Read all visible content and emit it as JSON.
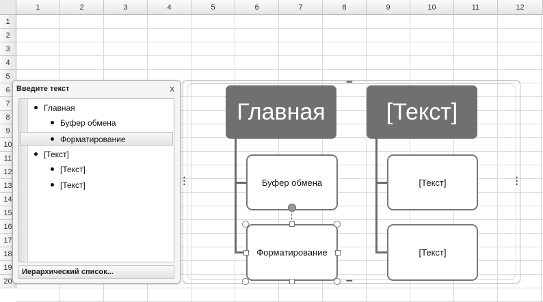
{
  "columns": [
    "1",
    "2",
    "3",
    "4",
    "5",
    "6",
    "7",
    "8",
    "9",
    "10",
    "11",
    "12"
  ],
  "rows": [
    "1",
    "2",
    "3",
    "4",
    "5",
    "6",
    "7",
    "8",
    "9",
    "10",
    "11",
    "12",
    "13",
    "14",
    "15",
    "16",
    "17",
    "18",
    "19",
    "20"
  ],
  "text_pane": {
    "title": "Введите текст",
    "close": "x",
    "items": [
      {
        "text": "Главная",
        "level": 1
      },
      {
        "text": "Буфер обмена",
        "level": 2
      },
      {
        "text": "Форматирование",
        "level": 2,
        "selected": true
      },
      {
        "text": "[Текст]",
        "level": 1
      },
      {
        "text": "[Текст]",
        "level": 2
      },
      {
        "text": "[Текст]",
        "level": 2
      }
    ],
    "footer": "Иерархический список..."
  },
  "diagram": {
    "main1": "Главная",
    "main2": "[Текст]",
    "sub1": "Буфер обмена",
    "sub2": "Форматирование",
    "sub3": "[Текст]",
    "sub4": "[Текст]"
  }
}
